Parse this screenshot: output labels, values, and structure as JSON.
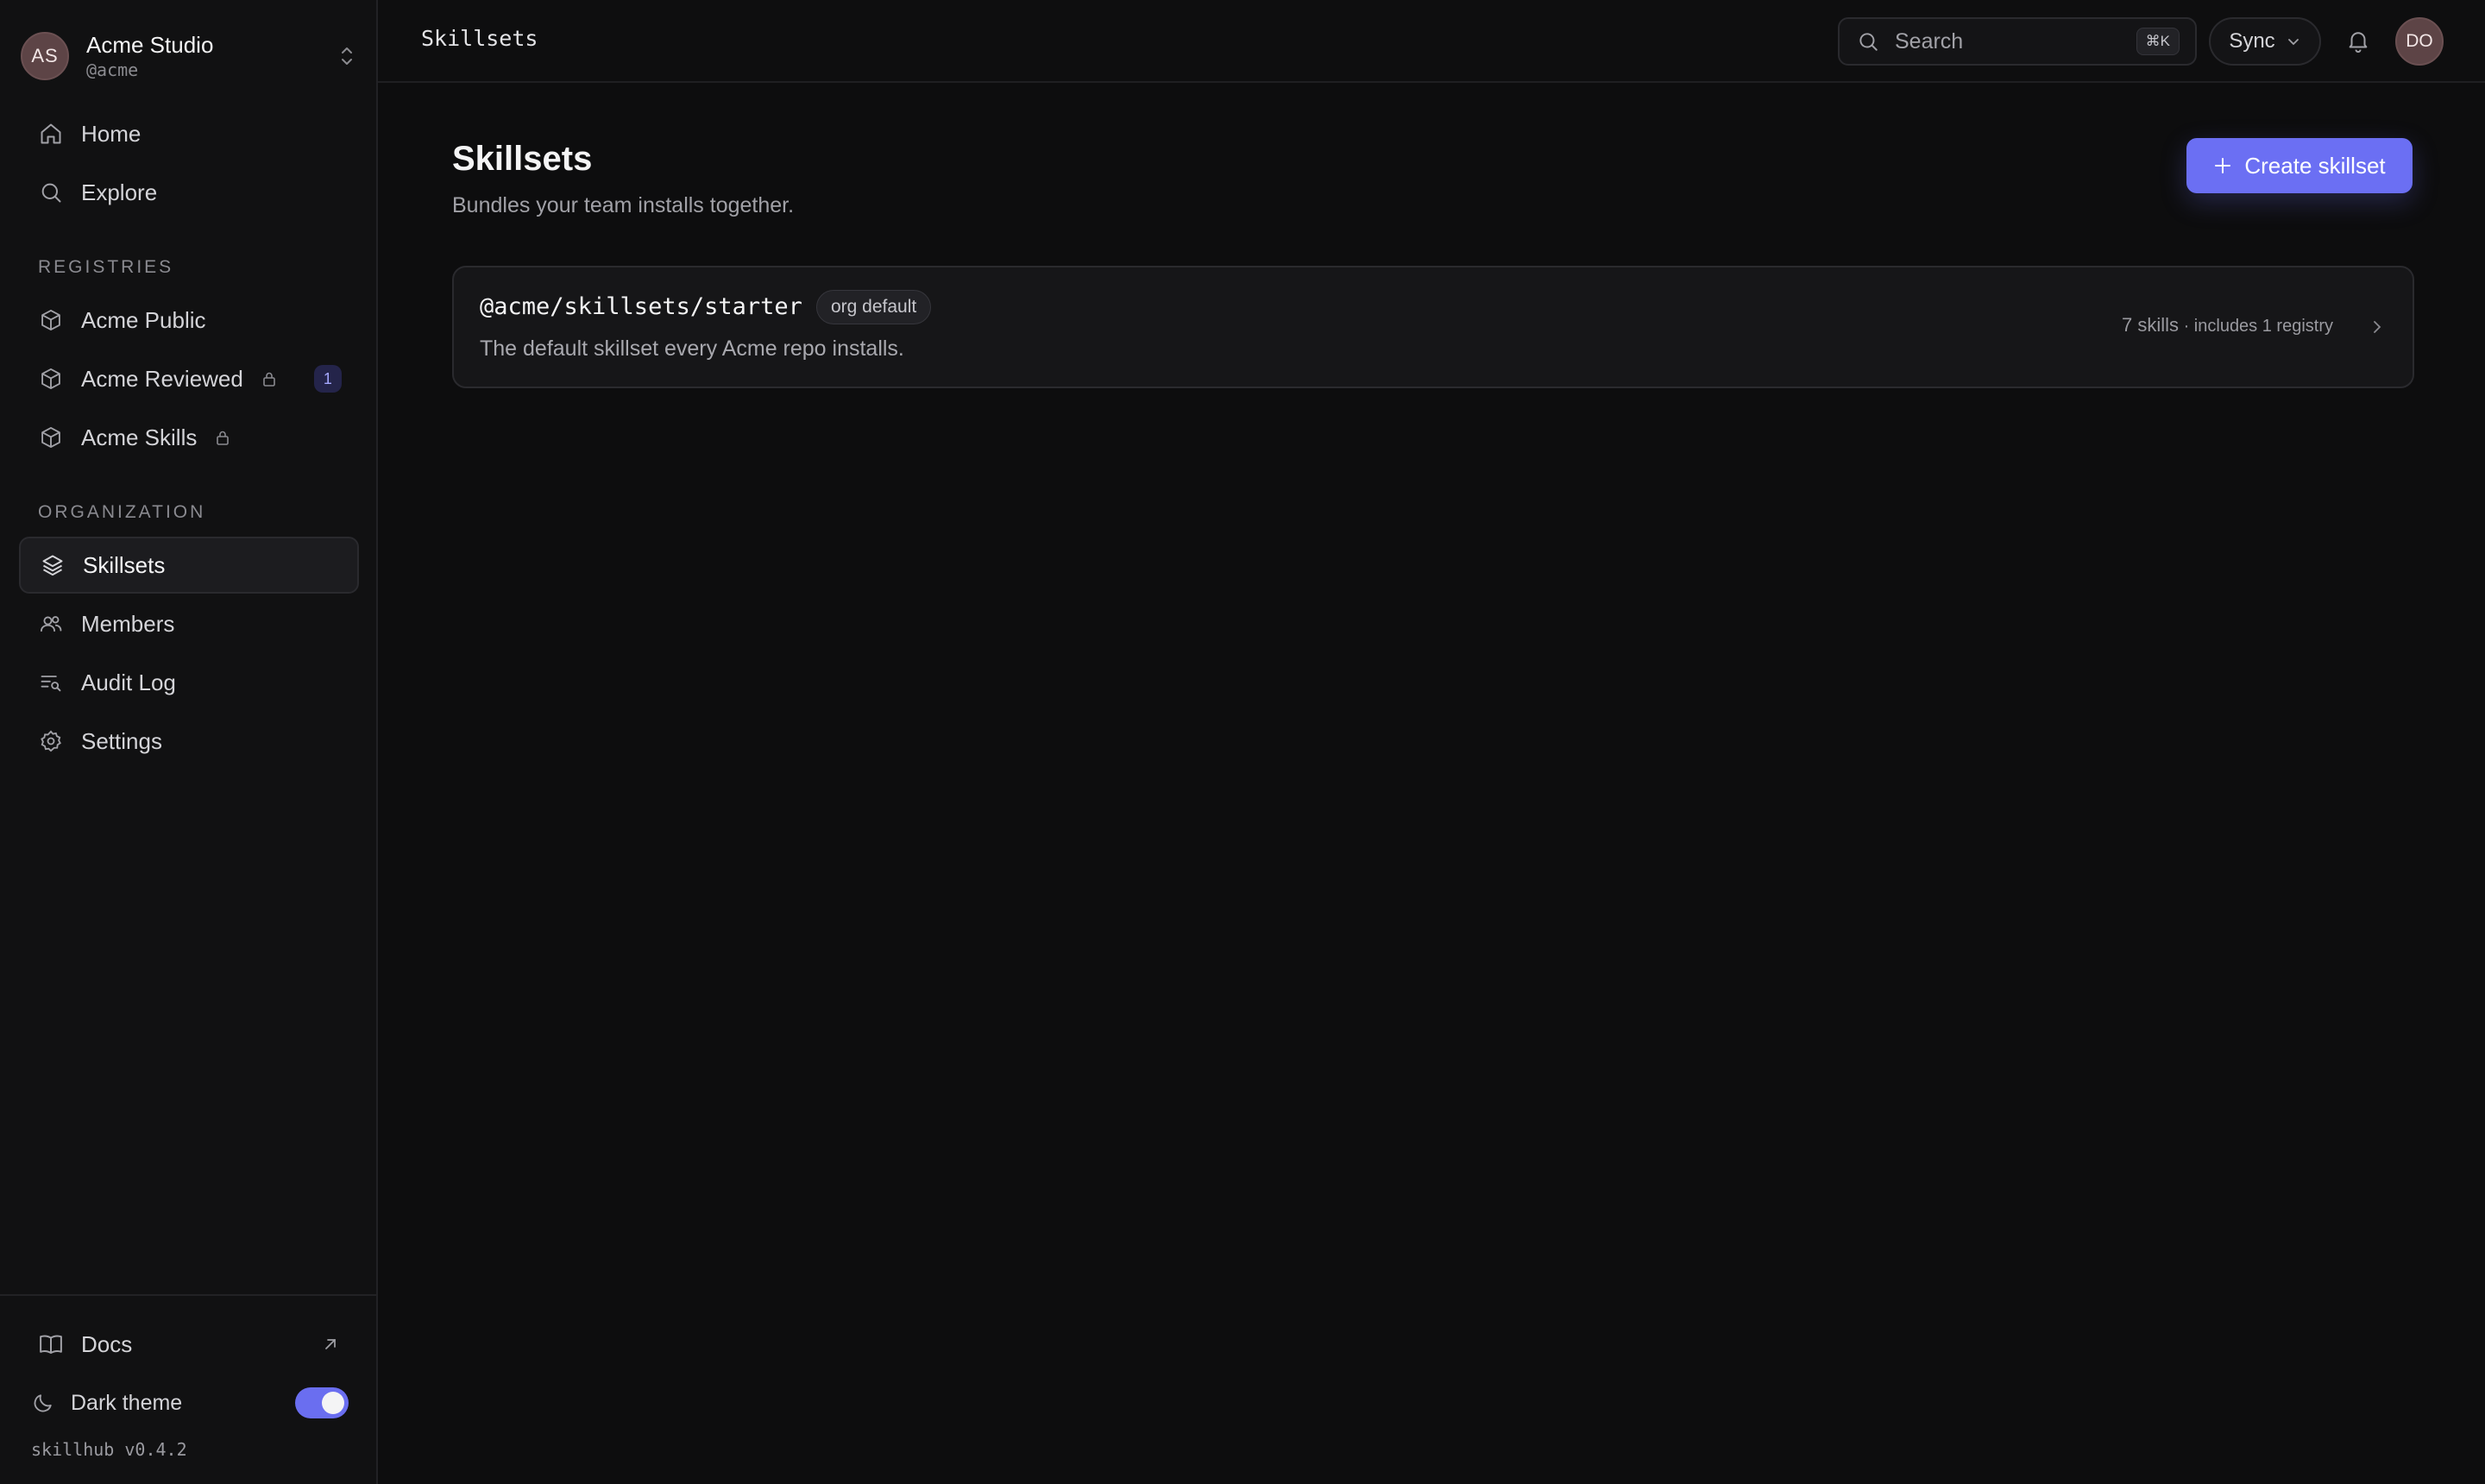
{
  "org": {
    "initials": "AS",
    "name": "Acme Studio",
    "handle": "@acme"
  },
  "nav": {
    "home": "Home",
    "explore": "Explore"
  },
  "registries": {
    "label": "REGISTRIES",
    "items": [
      {
        "label": "Acme Public",
        "locked": false
      },
      {
        "label": "Acme Reviewed",
        "locked": true,
        "badge": "1"
      },
      {
        "label": "Acme Skills",
        "locked": true
      }
    ]
  },
  "organization": {
    "label": "ORGANIZATION",
    "items": [
      {
        "label": "Skillsets",
        "active": true
      },
      {
        "label": "Members"
      },
      {
        "label": "Audit Log"
      },
      {
        "label": "Settings"
      }
    ]
  },
  "footer": {
    "docs": "Docs",
    "dark_theme": "Dark theme",
    "dark_theme_on": true,
    "version": "skillhub v0.4.2"
  },
  "topbar": {
    "title": "Skillsets",
    "search_placeholder": "Search",
    "search_shortcut": "⌘K",
    "sync_label": "Sync",
    "user_initials": "DO"
  },
  "page": {
    "title": "Skillsets",
    "subtitle": "Bundles your team installs together.",
    "create_label": "Create skillset"
  },
  "skillsets": [
    {
      "name": "@acme/skillsets/starter",
      "tag": "org default",
      "description": "The default skillset every Acme repo installs.",
      "skills_count": "7 skills",
      "includes": " · includes 1 registry"
    }
  ],
  "colors": {
    "accent": "#6b6ff3",
    "background": "#0d0d0e",
    "sidebar": "#111112",
    "avatar": "#5d4446"
  }
}
